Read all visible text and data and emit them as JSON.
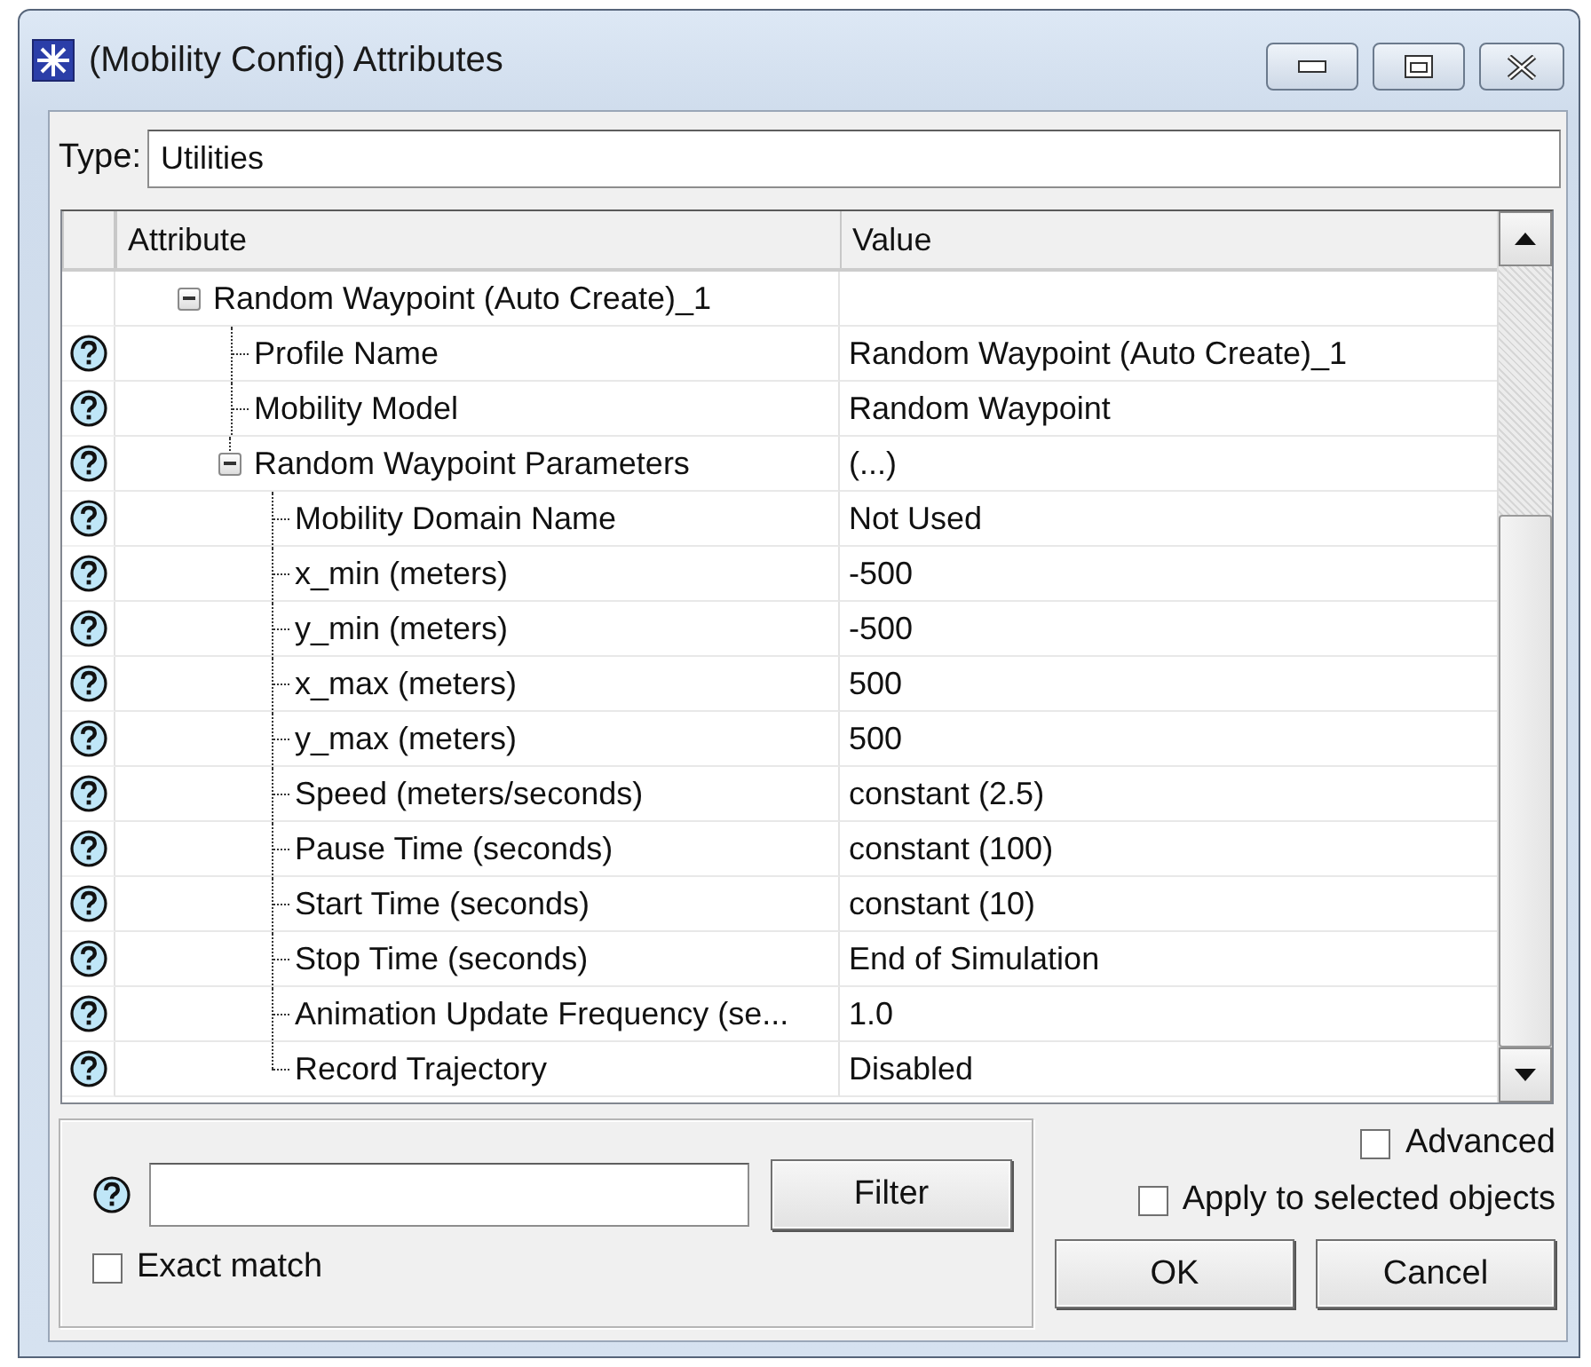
{
  "window": {
    "title": "(Mobility Config) Attributes"
  },
  "type_field": {
    "label": "Type:",
    "value": "Utilities"
  },
  "table": {
    "columns": [
      "Attribute",
      "Value"
    ],
    "rows": [
      {
        "attribute": "Random Waypoint (Auto Create)_1",
        "help": false,
        "expanded": true,
        "children": [
          {
            "attribute": "Profile Name",
            "value": "Random Waypoint (Auto Create)_1",
            "help": true
          },
          {
            "attribute": "Mobility Model",
            "value": "Random Waypoint",
            "help": true
          },
          {
            "attribute": "Random Waypoint Parameters",
            "value": "(...)",
            "help": true,
            "expanded": true,
            "children": [
              {
                "attribute": "Mobility Domain Name",
                "value": "Not Used",
                "help": true
              },
              {
                "attribute": "x_min (meters)",
                "value": "-500",
                "help": true
              },
              {
                "attribute": "y_min (meters)",
                "value": "-500",
                "help": true
              },
              {
                "attribute": "x_max (meters)",
                "value": "500",
                "help": true
              },
              {
                "attribute": "y_max (meters)",
                "value": "500",
                "help": true
              },
              {
                "attribute": "Speed (meters/seconds)",
                "value": "constant (2.5)",
                "help": true
              },
              {
                "attribute": "Pause Time (seconds)",
                "value": "constant (100)",
                "help": true
              },
              {
                "attribute": "Start Time (seconds)",
                "value": "constant (10)",
                "help": true
              },
              {
                "attribute": "Stop Time (seconds)",
                "value": "End of Simulation",
                "help": true
              },
              {
                "attribute": "Animation Update Frequency (se...",
                "value": "1.0",
                "help": true
              },
              {
                "attribute": "Record Trajectory",
                "value": "Disabled",
                "help": true
              }
            ]
          }
        ]
      }
    ]
  },
  "filter": {
    "button": "Filter",
    "exact_match": {
      "label": "Exact match",
      "checked": false
    }
  },
  "advanced": {
    "label": "Advanced",
    "checked": false
  },
  "apply_to_selected": {
    "label": "Apply to selected objects",
    "checked": false
  },
  "buttons": [
    "OK",
    "Cancel"
  ]
}
